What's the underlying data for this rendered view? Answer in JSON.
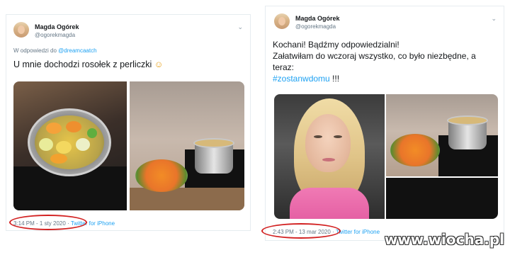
{
  "tweet1": {
    "author_name": "Magda Ogórek",
    "handle": "@ogorekmagda",
    "reply_prefix": "W odpowiedzi do",
    "reply_mention": "@dreamcaatch",
    "text": "U mnie dochodzi rosołek z perliczki",
    "emoji": "☺",
    "time": "3:14 PM - 1 sty 2020",
    "separator": "·",
    "source": "Twitter for iPhone"
  },
  "tweet2": {
    "author_name": "Magda Ogórek",
    "handle": "@ogorekmagda",
    "line1": "Kochani! Bądźmy odpowiedzialni!",
    "line2": "Załatwiłam do wczoraj wszystko, co było niezbędne, a",
    "line3": "teraz:",
    "hashtag": "#zostanwdomu",
    "exclaim": " !!!",
    "time": "2:43 PM - 13 mar 2020",
    "separator": "·",
    "source": "Twitter for iPhone"
  },
  "watermark": "www.wiocha.pl",
  "icons": {
    "menu": "chevron-down-icon"
  },
  "colors": {
    "link": "#1da1f2",
    "highlight_circle": "#d22020",
    "muted": "#657786"
  }
}
